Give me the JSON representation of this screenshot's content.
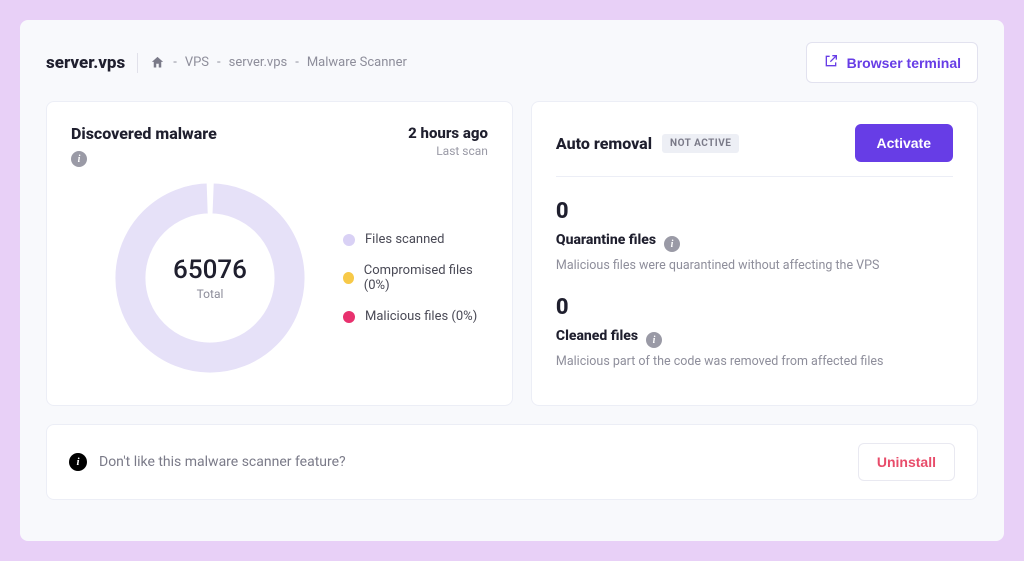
{
  "header": {
    "title": "server.vps",
    "breadcrumb": {
      "a": "VPS",
      "b": "server.vps",
      "c": "Malware Scanner",
      "sep": "-"
    },
    "terminal_label": "Browser terminal"
  },
  "discovered": {
    "title": "Discovered malware",
    "last_scan_time": "2 hours ago",
    "last_scan_label": "Last scan",
    "total_value": "65076",
    "total_label": "Total",
    "legend": {
      "scanned": "Files scanned",
      "compromised": "Compromised files (0%)",
      "malicious": "Malicious files (0%)"
    }
  },
  "auto": {
    "title": "Auto removal",
    "badge": "NOT ACTIVE",
    "activate_label": "Activate",
    "quarantine": {
      "count": "0",
      "title": "Quarantine files",
      "desc": "Malicious files were quarantined without affecting the VPS"
    },
    "cleaned": {
      "count": "0",
      "title": "Cleaned files",
      "desc": "Malicious part of the code was removed from affected files"
    }
  },
  "footer": {
    "text": "Don't like this malware scanner feature?",
    "uninstall_label": "Uninstall"
  },
  "colors": {
    "scanned": "#d9d1f5",
    "compromised": "#f7c948",
    "malicious": "#e8316e"
  },
  "chart_data": {
    "type": "pie",
    "title": "Discovered malware",
    "series": [
      {
        "name": "Files scanned",
        "value": 65076,
        "percent": 100,
        "color": "#d9d1f5"
      },
      {
        "name": "Compromised files",
        "value": 0,
        "percent": 0,
        "color": "#f7c948"
      },
      {
        "name": "Malicious files",
        "value": 0,
        "percent": 0,
        "color": "#e8316e"
      }
    ],
    "total": 65076,
    "total_label": "Total"
  }
}
